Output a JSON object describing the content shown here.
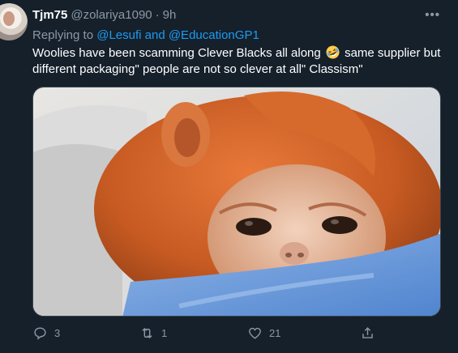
{
  "author": {
    "name": "Tjm75",
    "handle": "@zolariya1090",
    "separator": "·",
    "time": "9h"
  },
  "more_label": "•••",
  "reply": {
    "prefix": "Replying to",
    "mentions": "@Lesufi and @EducationGP1"
  },
  "tweet": {
    "text_part1": "Woolies have been scamming Clever Blacks all along",
    "emoji": "rolling-on-floor-laughing-emoji",
    "text_part2": "same supplier but different packaging\" people are not so clever at all\" Classism\""
  },
  "media": {
    "subject": "baby-monkey-photo"
  },
  "actions": {
    "reply_count": "3",
    "retweet_count": "1",
    "like_count": "21"
  },
  "colors": {
    "background": "#15202b",
    "text": "#ffffff",
    "muted": "#8b98a5",
    "link": "#1d9bf0"
  }
}
